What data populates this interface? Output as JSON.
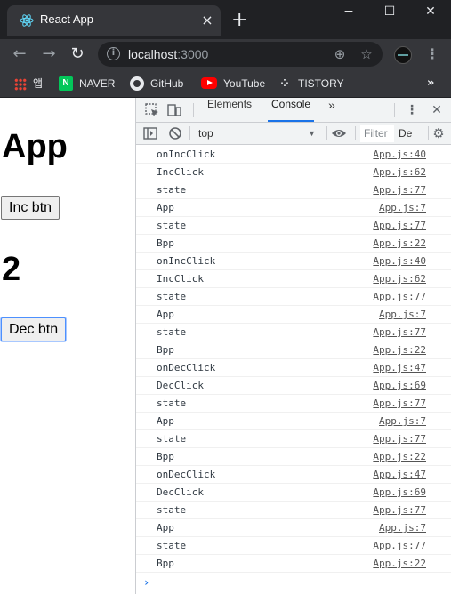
{
  "browser": {
    "tab_title": "React App",
    "tab_close": "×",
    "new_tab": "+",
    "window_controls": {
      "minimize": "−",
      "maximize": "☐",
      "close": "✕"
    },
    "back": "←",
    "forward": "→",
    "reload": "↻",
    "url_host": "localhost",
    "url_port": ":3000",
    "zoom_icon": "⊕",
    "star_icon": "☆",
    "menu": "⋮"
  },
  "bookmarks": {
    "items": [
      {
        "label": "앱",
        "icon": "apps-grid-icon"
      },
      {
        "label": "NAVER",
        "icon": "naver-icon"
      },
      {
        "label": "GitHub",
        "icon": "github-icon"
      },
      {
        "label": "YouTube",
        "icon": "youtube-icon"
      },
      {
        "label": "TISTORY",
        "icon": "tistory-icon"
      }
    ],
    "more": "»"
  },
  "page": {
    "heading": "App",
    "inc_button": "Inc btn",
    "count": "2",
    "dec_button": "Dec btn"
  },
  "devtools": {
    "tabs": [
      "Elements",
      "Console"
    ],
    "active_tab": "Console",
    "more_tabs": "»",
    "context": "top",
    "filter_placeholder": "Filter",
    "levels": "De",
    "logs": [
      {
        "msg": "onIncClick",
        "src": "App.js:40"
      },
      {
        "msg": "IncClick",
        "src": "App.js:62"
      },
      {
        "msg": "state",
        "src": "App.js:77"
      },
      {
        "msg": "App",
        "src": "App.js:7"
      },
      {
        "msg": "state",
        "src": "App.js:77"
      },
      {
        "msg": "Bpp",
        "src": "App.js:22"
      },
      {
        "msg": "onIncClick",
        "src": "App.js:40"
      },
      {
        "msg": "IncClick",
        "src": "App.js:62"
      },
      {
        "msg": "state",
        "src": "App.js:77"
      },
      {
        "msg": "App",
        "src": "App.js:7"
      },
      {
        "msg": "state",
        "src": "App.js:77"
      },
      {
        "msg": "Bpp",
        "src": "App.js:22"
      },
      {
        "msg": "onDecClick",
        "src": "App.js:47"
      },
      {
        "msg": "DecClick",
        "src": "App.js:69"
      },
      {
        "msg": "state",
        "src": "App.js:77"
      },
      {
        "msg": "App",
        "src": "App.js:7"
      },
      {
        "msg": "state",
        "src": "App.js:77"
      },
      {
        "msg": "Bpp",
        "src": "App.js:22"
      },
      {
        "msg": "onDecClick",
        "src": "App.js:47"
      },
      {
        "msg": "DecClick",
        "src": "App.js:69"
      },
      {
        "msg": "state",
        "src": "App.js:77"
      },
      {
        "msg": "App",
        "src": "App.js:7"
      },
      {
        "msg": "state",
        "src": "App.js:77"
      },
      {
        "msg": "Bpp",
        "src": "App.js:22"
      }
    ],
    "prompt": "›"
  }
}
